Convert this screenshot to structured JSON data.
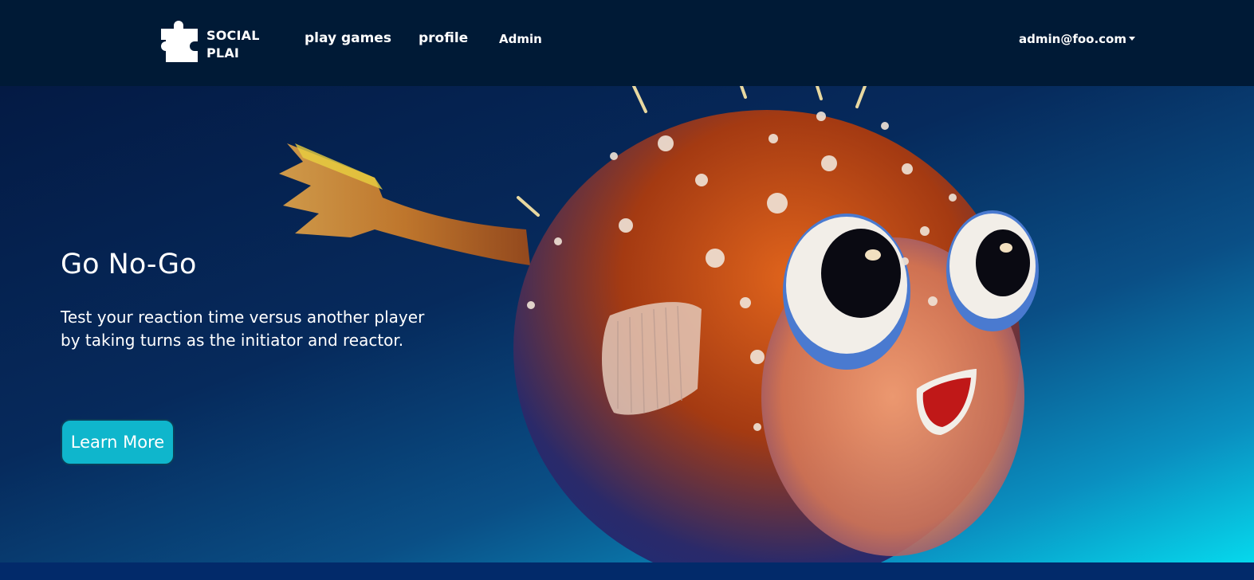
{
  "navbar": {
    "brand_line1": "SOCIAL",
    "brand_line2": "PLAI",
    "brand_icon": "puzzle-piece-icon",
    "links": {
      "play_games": "play games",
      "profile": "profile",
      "admin": "Admin"
    },
    "user": {
      "email": "admin@foo.com"
    }
  },
  "hero": {
    "title": "Go No-Go",
    "description": "Test your reaction time versus another player by taking turns as the initiator and reactor.",
    "button_label": "Learn More",
    "illustration": "pufferfish-image"
  },
  "colors": {
    "navbar_bg": "#001a36",
    "hero_gradient_start": "#041a44",
    "hero_gradient_end": "#06d8ec",
    "button_bg": "#0fb6cc",
    "footer_strip": "#022a6a"
  }
}
